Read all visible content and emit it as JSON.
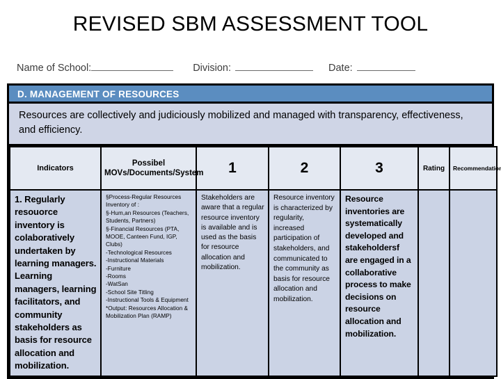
{
  "document": {
    "title": "REVISED SBM ASSESSMENT TOOL"
  },
  "form": {
    "school_label": "Name of School:",
    "division_label": "Division:",
    "date_label": "Date:",
    "school_value": "",
    "division_value": "",
    "date_value": ""
  },
  "section": {
    "band_label": "D. MANAGEMENT  OF RESOURCES",
    "description": "Resources are collectively and judiciously mobilized and managed with transparency, effectiveness, and efficiency."
  },
  "table": {
    "headers": {
      "indicators": "Indicators",
      "movs": "Possibel MOVs/Documents/System",
      "level1": "1",
      "level2": "2",
      "level3": "3",
      "rating": "Rating",
      "recommendation": "Recommendation"
    },
    "rows": [
      {
        "indicator": "1. Regularly resouorce inventory is colaboratively undertaken by learning managers. Learning managers, learning facilitators, and community stakeholders as basis for resource allocation and mobilization.",
        "movs_lines": [
          "§Process-Regular Resources Inventory of :",
          "§-Hum,an Resources (Teachers, Students, Partners)",
          "§-Financial Resources (PTA, MOOE, Canteen Fund, IGP, Clubs)",
          "-Technological Resources",
          "-Instructional Materials",
          "-Furniture",
          "-Rooms",
          "-WatSan",
          "-School Site Titling",
          "-Instructional Tools & Equipment",
          "*Output: Resources Allocation & Mobilization Plan (RAMP)"
        ],
        "level1": "Stakeholders are aware that a regular resource inventory is available and is used as the basis for resource allocation and mobilization.",
        "level2": "Resource inventory is characterized by regularity, increased participation of stakeholders, and communicated to the community as basis for resource allocation and mobilization.",
        "level3": "Resource inventories are systematically developed and stakeholdersf are engaged in a collaborative process to make decisions on resource allocation and mobilization.",
        "rating": "",
        "recommendation": ""
      }
    ]
  },
  "colors": {
    "band_blue": "#5b8dc0",
    "description_fill": "#cfd5e6",
    "header_fill": "#e4e9f2",
    "body_fill": "#cbd3e5",
    "border": "#000000"
  }
}
